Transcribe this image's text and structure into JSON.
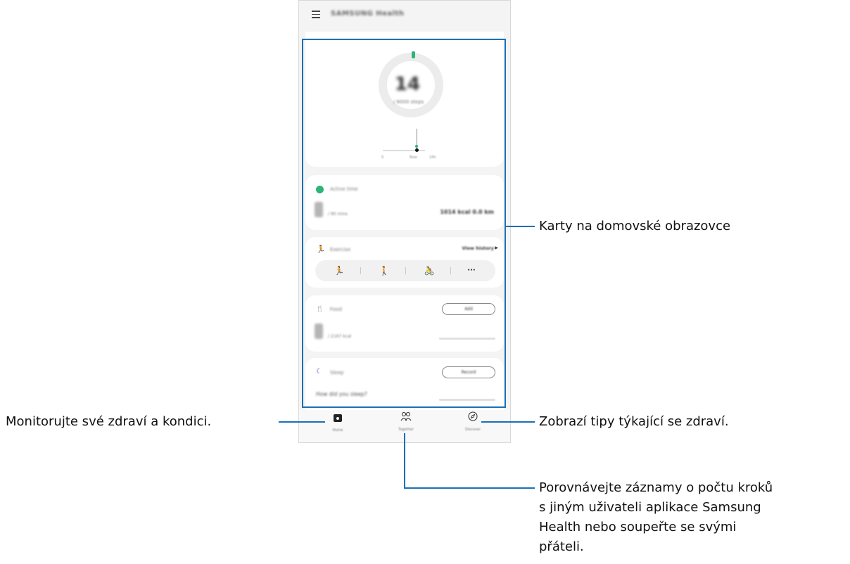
{
  "app": {
    "title": "SAMSUNG Health"
  },
  "steps_card": {
    "value": "14",
    "goal": "/ 6000 steps",
    "graph_labels": [
      "0",
      "Now",
      "24h"
    ],
    "progress_fraction": 0.01
  },
  "active_time_card": {
    "label": "Active time",
    "unit": "/ 90 mins",
    "stats": "1014 kcal  0.0 km"
  },
  "exercise_card": {
    "label": "Exercise",
    "view_history": "View history",
    "buttons": [
      {
        "icon": "running-icon",
        "glyph": "🏃"
      },
      {
        "icon": "walking-icon",
        "glyph": "🚶"
      },
      {
        "icon": "cycling-icon",
        "glyph": "🚴"
      },
      {
        "icon": "more-icon",
        "glyph": "···"
      }
    ]
  },
  "food_card": {
    "label": "Food",
    "button": "Add",
    "unit": "/ 2167 kcal"
  },
  "sleep_card": {
    "label": "Sleep",
    "button": "Record",
    "question": "How did you sleep?"
  },
  "bottom_nav": {
    "items": [
      {
        "label": "Home",
        "icon": "home-icon"
      },
      {
        "label": "Together",
        "icon": "people-icon"
      },
      {
        "label": "Discover",
        "icon": "compass-icon"
      }
    ]
  },
  "annotations": {
    "cards": "Karty na domovské obrazovce",
    "home": "Monitorujte své zdraví a kondici.",
    "discover": "Zobrazí tipy týkající se zdraví.",
    "together_lines": [
      "Porovnávejte záznamy o počtu kroků",
      "s jiným uživateli aplikace Samsung",
      "Health nebo soupeřte se svými",
      "přáteli."
    ]
  },
  "colors": {
    "accent": "#1b70b5",
    "green": "#2bb673",
    "sleep": "#5561c4"
  }
}
